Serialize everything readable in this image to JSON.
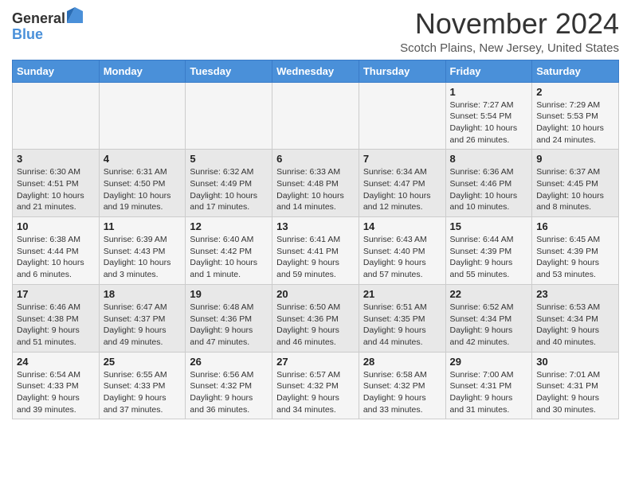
{
  "logo": {
    "general": "General",
    "blue": "Blue"
  },
  "header": {
    "month": "November 2024",
    "location": "Scotch Plains, New Jersey, United States"
  },
  "weekdays": [
    "Sunday",
    "Monday",
    "Tuesday",
    "Wednesday",
    "Thursday",
    "Friday",
    "Saturday"
  ],
  "weeks": [
    [
      {
        "day": "",
        "info": ""
      },
      {
        "day": "",
        "info": ""
      },
      {
        "day": "",
        "info": ""
      },
      {
        "day": "",
        "info": ""
      },
      {
        "day": "",
        "info": ""
      },
      {
        "day": "1",
        "info": "Sunrise: 7:27 AM\nSunset: 5:54 PM\nDaylight: 10 hours and 26 minutes."
      },
      {
        "day": "2",
        "info": "Sunrise: 7:29 AM\nSunset: 5:53 PM\nDaylight: 10 hours and 24 minutes."
      }
    ],
    [
      {
        "day": "3",
        "info": "Sunrise: 6:30 AM\nSunset: 4:51 PM\nDaylight: 10 hours and 21 minutes."
      },
      {
        "day": "4",
        "info": "Sunrise: 6:31 AM\nSunset: 4:50 PM\nDaylight: 10 hours and 19 minutes."
      },
      {
        "day": "5",
        "info": "Sunrise: 6:32 AM\nSunset: 4:49 PM\nDaylight: 10 hours and 17 minutes."
      },
      {
        "day": "6",
        "info": "Sunrise: 6:33 AM\nSunset: 4:48 PM\nDaylight: 10 hours and 14 minutes."
      },
      {
        "day": "7",
        "info": "Sunrise: 6:34 AM\nSunset: 4:47 PM\nDaylight: 10 hours and 12 minutes."
      },
      {
        "day": "8",
        "info": "Sunrise: 6:36 AM\nSunset: 4:46 PM\nDaylight: 10 hours and 10 minutes."
      },
      {
        "day": "9",
        "info": "Sunrise: 6:37 AM\nSunset: 4:45 PM\nDaylight: 10 hours and 8 minutes."
      }
    ],
    [
      {
        "day": "10",
        "info": "Sunrise: 6:38 AM\nSunset: 4:44 PM\nDaylight: 10 hours and 6 minutes."
      },
      {
        "day": "11",
        "info": "Sunrise: 6:39 AM\nSunset: 4:43 PM\nDaylight: 10 hours and 3 minutes."
      },
      {
        "day": "12",
        "info": "Sunrise: 6:40 AM\nSunset: 4:42 PM\nDaylight: 10 hours and 1 minute."
      },
      {
        "day": "13",
        "info": "Sunrise: 6:41 AM\nSunset: 4:41 PM\nDaylight: 9 hours and 59 minutes."
      },
      {
        "day": "14",
        "info": "Sunrise: 6:43 AM\nSunset: 4:40 PM\nDaylight: 9 hours and 57 minutes."
      },
      {
        "day": "15",
        "info": "Sunrise: 6:44 AM\nSunset: 4:39 PM\nDaylight: 9 hours and 55 minutes."
      },
      {
        "day": "16",
        "info": "Sunrise: 6:45 AM\nSunset: 4:39 PM\nDaylight: 9 hours and 53 minutes."
      }
    ],
    [
      {
        "day": "17",
        "info": "Sunrise: 6:46 AM\nSunset: 4:38 PM\nDaylight: 9 hours and 51 minutes."
      },
      {
        "day": "18",
        "info": "Sunrise: 6:47 AM\nSunset: 4:37 PM\nDaylight: 9 hours and 49 minutes."
      },
      {
        "day": "19",
        "info": "Sunrise: 6:48 AM\nSunset: 4:36 PM\nDaylight: 9 hours and 47 minutes."
      },
      {
        "day": "20",
        "info": "Sunrise: 6:50 AM\nSunset: 4:36 PM\nDaylight: 9 hours and 46 minutes."
      },
      {
        "day": "21",
        "info": "Sunrise: 6:51 AM\nSunset: 4:35 PM\nDaylight: 9 hours and 44 minutes."
      },
      {
        "day": "22",
        "info": "Sunrise: 6:52 AM\nSunset: 4:34 PM\nDaylight: 9 hours and 42 minutes."
      },
      {
        "day": "23",
        "info": "Sunrise: 6:53 AM\nSunset: 4:34 PM\nDaylight: 9 hours and 40 minutes."
      }
    ],
    [
      {
        "day": "24",
        "info": "Sunrise: 6:54 AM\nSunset: 4:33 PM\nDaylight: 9 hours and 39 minutes."
      },
      {
        "day": "25",
        "info": "Sunrise: 6:55 AM\nSunset: 4:33 PM\nDaylight: 9 hours and 37 minutes."
      },
      {
        "day": "26",
        "info": "Sunrise: 6:56 AM\nSunset: 4:32 PM\nDaylight: 9 hours and 36 minutes."
      },
      {
        "day": "27",
        "info": "Sunrise: 6:57 AM\nSunset: 4:32 PM\nDaylight: 9 hours and 34 minutes."
      },
      {
        "day": "28",
        "info": "Sunrise: 6:58 AM\nSunset: 4:32 PM\nDaylight: 9 hours and 33 minutes."
      },
      {
        "day": "29",
        "info": "Sunrise: 7:00 AM\nSunset: 4:31 PM\nDaylight: 9 hours and 31 minutes."
      },
      {
        "day": "30",
        "info": "Sunrise: 7:01 AM\nSunset: 4:31 PM\nDaylight: 9 hours and 30 minutes."
      }
    ]
  ]
}
